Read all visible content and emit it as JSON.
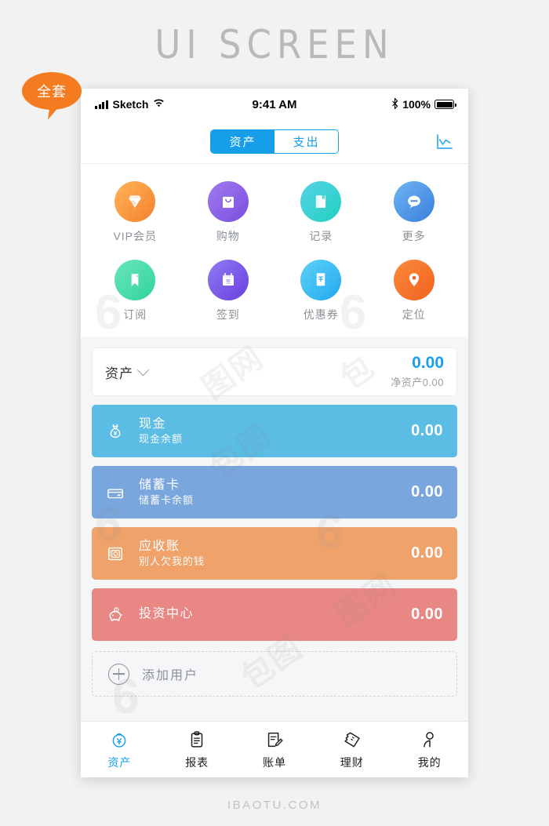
{
  "poster": {
    "title": "UI SCREEN",
    "brand_footer": "IBAOTU.COM",
    "badge": "全套"
  },
  "status_bar": {
    "carrier": "Sketch",
    "time": "9:41 AM",
    "battery_percent": "100%",
    "signal_icon": "signal-bars-icon",
    "wifi_icon": "wifi-icon",
    "bluetooth_icon": "bluetooth-icon",
    "battery_icon": "battery-icon"
  },
  "nav": {
    "segments": [
      {
        "label": "资产",
        "active": true
      },
      {
        "label": "支出",
        "active": false
      }
    ],
    "chart_icon": "line-chart-icon"
  },
  "icon_grid": [
    {
      "label": "VIP会员",
      "icon": "diamond-icon",
      "color_start": "#ffb45c",
      "color_end": "#f4812a"
    },
    {
      "label": "购物",
      "icon": "shopping-bag-icon",
      "color_start": "#a07bf0",
      "color_end": "#7a4ede"
    },
    {
      "label": "记录",
      "icon": "notebook-icon",
      "color_start": "#58d3e8",
      "color_end": "#20d0c0"
    },
    {
      "label": "更多",
      "icon": "chat-dots-icon",
      "color_start": "#6db4f2",
      "color_end": "#3b7fdb"
    },
    {
      "label": "订阅",
      "icon": "bookmark-icon",
      "color_start": "#6ae6c0",
      "color_end": "#2fd39a"
    },
    {
      "label": "签到",
      "icon": "calendar-check-icon",
      "color_start": "#8f7bf2",
      "color_end": "#6a3fe0"
    },
    {
      "label": "优惠券",
      "icon": "receipt-icon",
      "color_start": "#5fd2f7",
      "color_end": "#22a8ef"
    },
    {
      "label": "定位",
      "icon": "location-pin-icon",
      "color_start": "#fa8b3c",
      "color_end": "#f2611d"
    }
  ],
  "summary": {
    "label": "资产",
    "caret_icon": "chevron-down-icon",
    "amount": "0.00",
    "amount_color": "#18a0ef",
    "sub": "净资产0.00"
  },
  "accounts": [
    {
      "title": "现金",
      "sub": "现金余额",
      "amount": "0.00",
      "icon": "money-bag-icon",
      "bg": "#5bbce4"
    },
    {
      "title": "储蓄卡",
      "sub": "储蓄卡余额",
      "amount": "0.00",
      "icon": "credit-card-icon",
      "bg": "#79a6dd"
    },
    {
      "title": "应收账",
      "sub": "别人欠我的钱",
      "amount": "0.00",
      "icon": "safe-box-icon",
      "bg": "#efa26a"
    },
    {
      "title": "投资中心",
      "sub": "",
      "amount": "0.00",
      "icon": "piggy-bank-icon",
      "bg": "#e98785"
    }
  ],
  "add_user": {
    "label": "添加用户",
    "icon": "plus-circle-icon"
  },
  "tab_bar": [
    {
      "label": "资产",
      "icon": "wallet-yen-icon",
      "active": true
    },
    {
      "label": "报表",
      "icon": "clipboard-icon",
      "active": false
    },
    {
      "label": "账单",
      "icon": "bill-edit-icon",
      "active": false
    },
    {
      "label": "理财",
      "icon": "ticket-icon",
      "active": false
    },
    {
      "label": "我的",
      "icon": "person-icon",
      "active": false
    }
  ],
  "colors": {
    "accent": "#18a0ef",
    "segment_blue": "#169fe8",
    "badge_orange": "#f47b20",
    "page_bg": "#f2f2f2",
    "app_bg": "#f4f6f8"
  }
}
